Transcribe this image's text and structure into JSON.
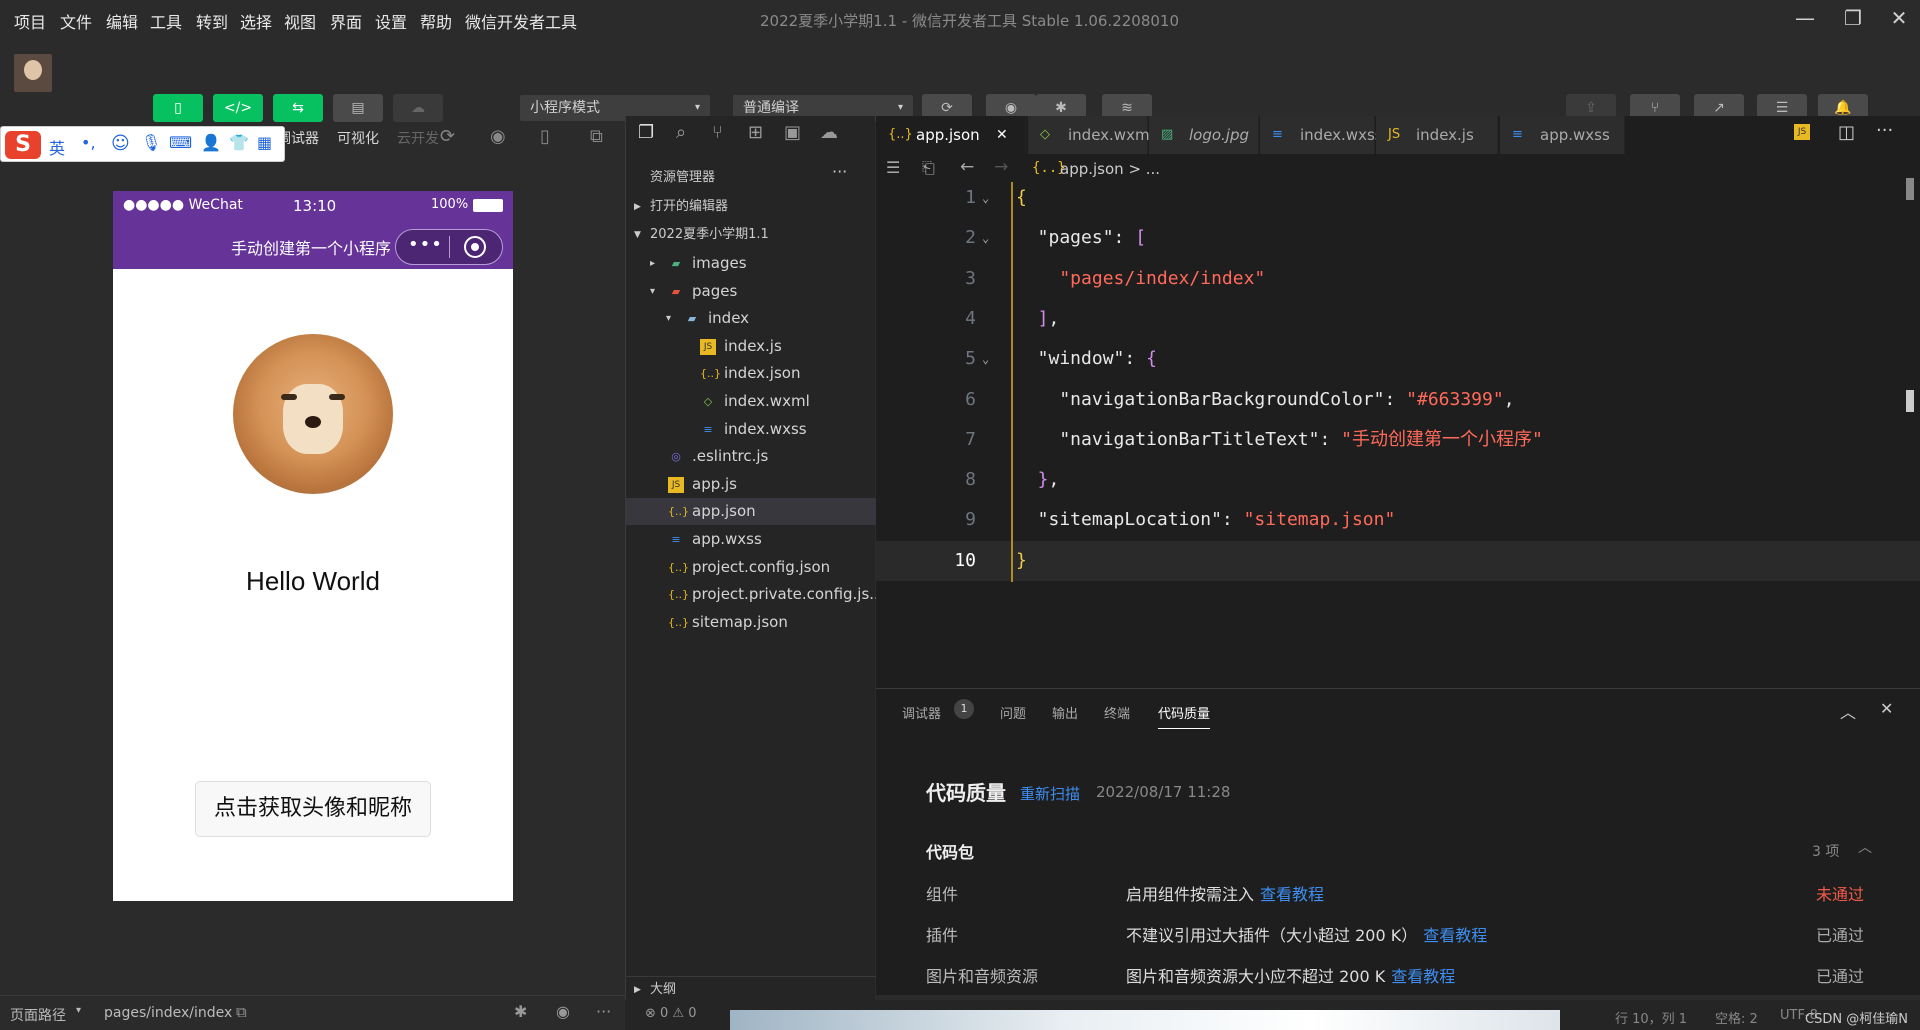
{
  "menu": [
    "项目",
    "文件",
    "编辑",
    "工具",
    "转到",
    "选择",
    "视图",
    "界面",
    "设置",
    "帮助",
    "微信开发者工具"
  ],
  "window_title": "2022夏季小学期1.1 - 微信开发者工具 Stable 1.06.2208010",
  "toolbar": {
    "left_buttons": [
      {
        "label": "模拟器",
        "icon": "phone-icon",
        "active": true
      },
      {
        "label": "编辑器",
        "icon": "code-icon",
        "active": true
      },
      {
        "label": "调试器",
        "icon": "debug-icon",
        "active": true
      },
      {
        "label": "可视化",
        "icon": "layout-icon",
        "active": false
      },
      {
        "label": "云开发",
        "icon": "cloud-icon",
        "active": false,
        "disabled": true
      }
    ],
    "mode_select": "小程序模式",
    "compile_select": "普通编译",
    "mid_buttons": [
      {
        "label": "编译",
        "icon": "refresh-icon"
      },
      {
        "label": "预览",
        "icon": "eye-icon"
      },
      {
        "label": "真机调试",
        "icon": "bug-icon"
      },
      {
        "label": "清缓存",
        "icon": "layers-icon"
      }
    ],
    "right_buttons": [
      {
        "label": "上传",
        "icon": "upload-icon",
        "disabled": true
      },
      {
        "label": "版本管理",
        "icon": "branch-icon"
      },
      {
        "label": "测试号",
        "icon": "external-icon"
      },
      {
        "label": "详情",
        "icon": "menu-icon"
      },
      {
        "label": "消息",
        "icon": "bell-icon"
      }
    ]
  },
  "ime_bar": {
    "lang": "英",
    "symbol": "•,"
  },
  "phone": {
    "signal": "●●●●● WeChat",
    "time": "13:10",
    "battery": "100%",
    "nav_title": "手动创建第一个小程序",
    "nav_bg": "#663399",
    "hello": "Hello World",
    "button": "点击获取头像和昵称"
  },
  "sim_footer": {
    "path_label": "页面路径",
    "path": "pages/index/index"
  },
  "explorer": {
    "title": "资源管理器",
    "more": "···",
    "sections": [
      "打开的编辑器",
      "2022夏季小学期1.1"
    ],
    "tree": [
      {
        "name": "images",
        "depth": 1,
        "kind": "folder-img",
        "caret": "▸"
      },
      {
        "name": "pages",
        "depth": 1,
        "kind": "folder-red",
        "caret": "▾"
      },
      {
        "name": "index",
        "depth": 2,
        "kind": "folder",
        "caret": "▾"
      },
      {
        "name": "index.js",
        "depth": 3,
        "kind": "js"
      },
      {
        "name": "index.json",
        "depth": 3,
        "kind": "json"
      },
      {
        "name": "index.wxml",
        "depth": 3,
        "kind": "wxml"
      },
      {
        "name": "index.wxss",
        "depth": 3,
        "kind": "wxss"
      },
      {
        "name": ".eslintrc.js",
        "depth": 1,
        "kind": "eslint"
      },
      {
        "name": "app.js",
        "depth": 1,
        "kind": "js"
      },
      {
        "name": "app.json",
        "depth": 1,
        "kind": "json",
        "selected": true
      },
      {
        "name": "app.wxss",
        "depth": 1,
        "kind": "wxss"
      },
      {
        "name": "project.config.json",
        "depth": 1,
        "kind": "json"
      },
      {
        "name": "project.private.config.js...",
        "depth": 1,
        "kind": "json"
      },
      {
        "name": "sitemap.json",
        "depth": 1,
        "kind": "json"
      }
    ],
    "outline": "大纲",
    "errors": "⊗ 0 ⚠ 0"
  },
  "tabs": [
    {
      "name": "app.json",
      "kind": "json",
      "active": true,
      "close": "✕"
    },
    {
      "name": "index.wxml",
      "kind": "wxml"
    },
    {
      "name": "logo.jpg",
      "kind": "img"
    },
    {
      "name": "index.wxss",
      "kind": "wxss"
    },
    {
      "name": "index.js",
      "kind": "js"
    },
    {
      "name": "app.wxss",
      "kind": "wxss"
    }
  ],
  "breadcrumb": "app.json > ...",
  "code": [
    {
      "n": "1",
      "t": [
        [
          "brace",
          "{"
        ]
      ]
    },
    {
      "n": "2",
      "t": [
        [
          "key",
          "  \"pages\""
        ],
        [
          "punc",
          ": "
        ],
        [
          "brack",
          "["
        ]
      ]
    },
    {
      "n": "3",
      "t": [
        [
          "str",
          "    \"pages/index/index\""
        ]
      ]
    },
    {
      "n": "4",
      "t": [
        [
          "brack",
          "  ]"
        ],
        [
          "punc",
          ","
        ]
      ]
    },
    {
      "n": "5",
      "t": [
        [
          "key",
          "  \"window\""
        ],
        [
          "punc",
          ": "
        ],
        [
          "brack",
          "{"
        ]
      ]
    },
    {
      "n": "6",
      "t": [
        [
          "key",
          "    \"navigationBarBackgroundColor\""
        ],
        [
          "punc",
          ": "
        ],
        [
          "str",
          "\"#663399\""
        ],
        [
          "punc",
          ","
        ]
      ]
    },
    {
      "n": "7",
      "t": [
        [
          "key",
          "    \"navigationBarTitleText\""
        ],
        [
          "punc",
          ": "
        ],
        [
          "str",
          "\"手动创建第一个小程序\""
        ]
      ]
    },
    {
      "n": "8",
      "t": [
        [
          "brack",
          "  }"
        ],
        [
          "punc",
          ","
        ]
      ]
    },
    {
      "n": "9",
      "t": [
        [
          "key",
          "  \"sitemapLocation\""
        ],
        [
          "punc",
          ": "
        ],
        [
          "str",
          "\"sitemap.json\""
        ]
      ]
    },
    {
      "n": "10",
      "t": [
        [
          "brace",
          "}"
        ]
      ]
    }
  ],
  "panel": {
    "tabs": [
      "调试器",
      "问题",
      "输出",
      "终端",
      "代码质量"
    ],
    "debug_badge": "1",
    "title": "代码质量",
    "rescan": "重新扫描",
    "date": "2022/08/17 11:28",
    "section": "代码包",
    "count": "3 项",
    "rows": [
      {
        "label": "组件",
        "desc": "启用组件按需注入",
        "link": "查看教程",
        "status": "未通过",
        "fail": true
      },
      {
        "label": "插件",
        "desc": "不建议引用过大插件（大小超过 200 K）",
        "link": "查看教程",
        "status": "已通过"
      },
      {
        "label": "图片和音频资源",
        "desc": "图片和音频资源大小应不超过 200 K",
        "link": "查看教程",
        "status": "已通过"
      }
    ]
  },
  "statusbar": {
    "pos": "行 10，列 1",
    "spaces": "空格: 2",
    "enc": "UTF-8",
    "wm": "CSDN @柯佳瑜N"
  }
}
